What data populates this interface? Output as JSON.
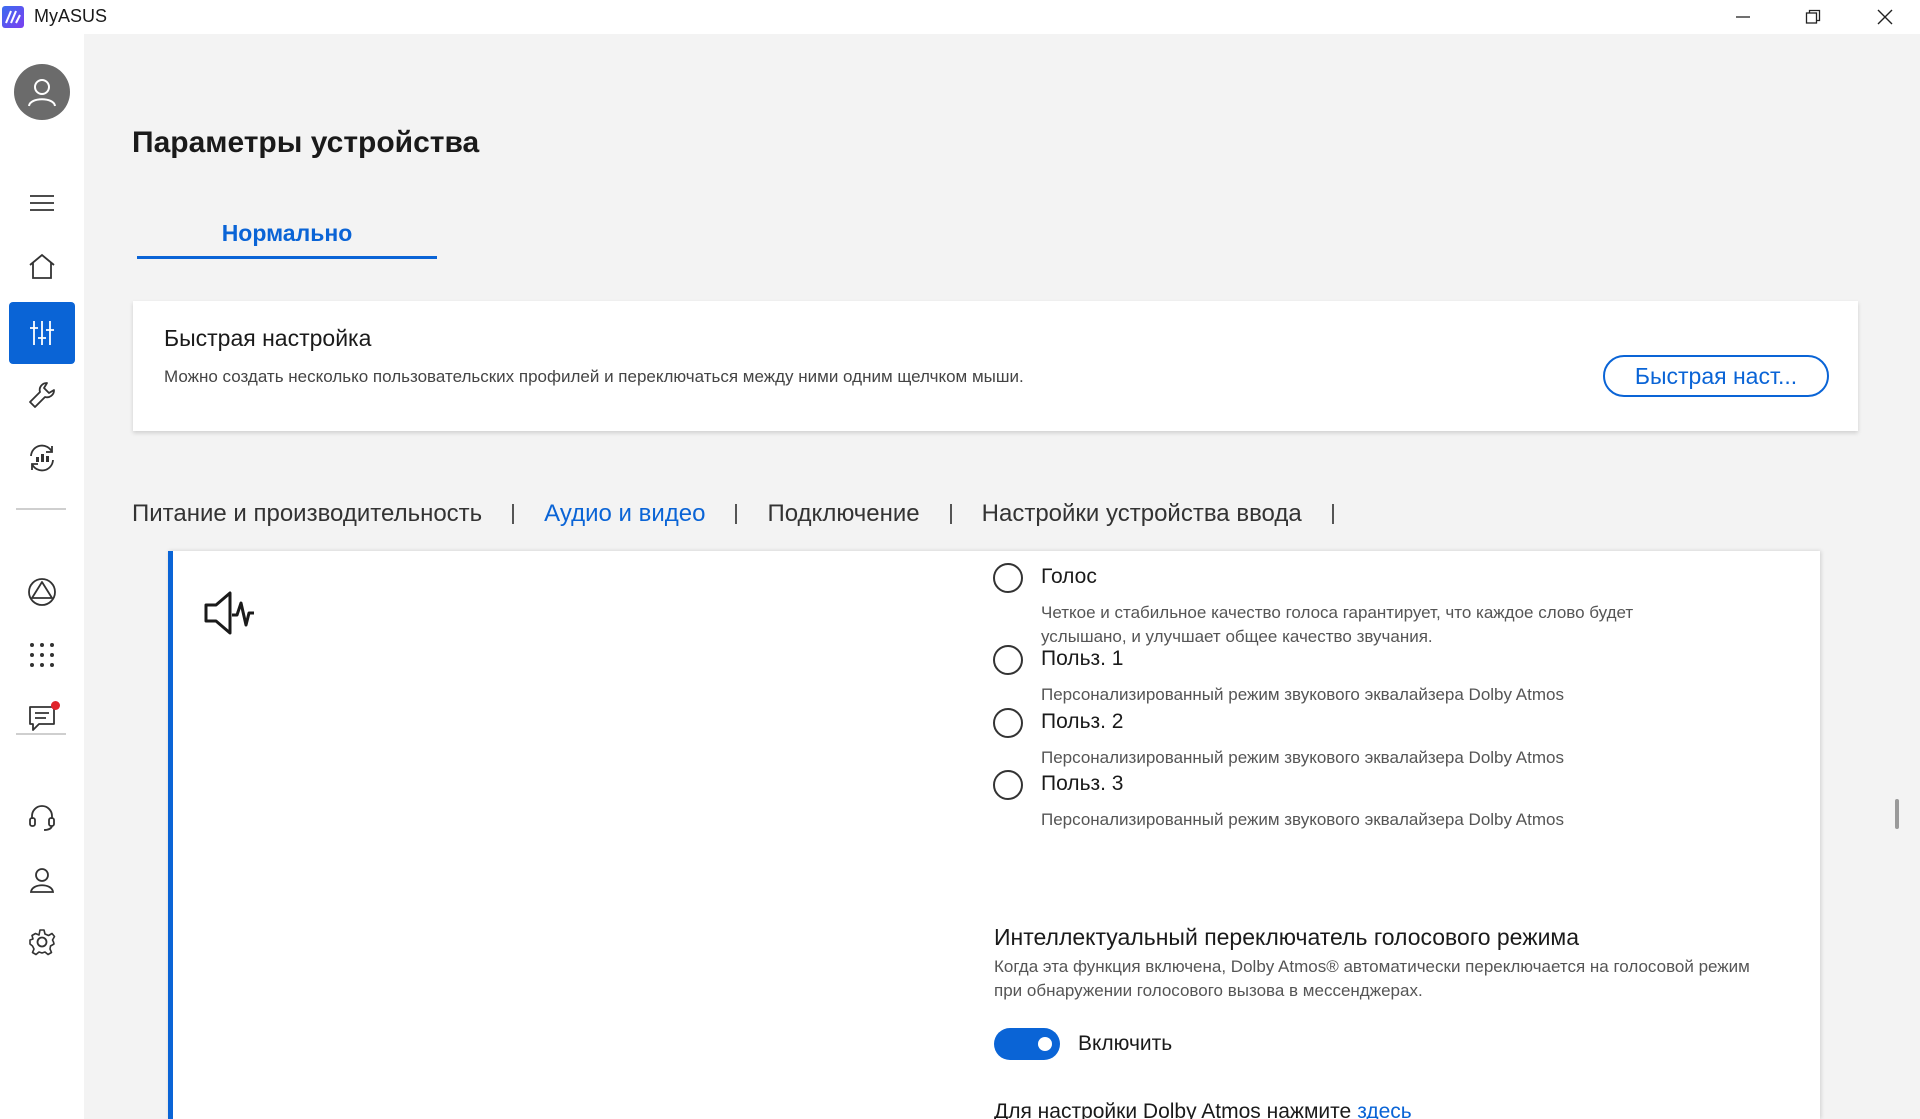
{
  "window": {
    "title": "MyASUS",
    "minimize_icon": "minimize-icon",
    "maximize_icon": "restore-icon",
    "close_icon": "close-icon"
  },
  "sidebar": {
    "items": [
      {
        "name": "menu",
        "icon": "hamburger-icon"
      },
      {
        "name": "home",
        "icon": "home-icon"
      },
      {
        "name": "device-settings",
        "icon": "sliders-icon",
        "active": true
      },
      {
        "name": "customization",
        "icon": "wrench-icon"
      },
      {
        "name": "system-diagnosis",
        "icon": "diagnosis-icon"
      },
      {
        "name": "link-to-myasus",
        "icon": "triangle-link-icon"
      },
      {
        "name": "apps",
        "icon": "grid-dots-icon"
      },
      {
        "name": "messages",
        "icon": "message-icon",
        "badge": true
      },
      {
        "name": "support",
        "icon": "headset-icon"
      },
      {
        "name": "account",
        "icon": "user-icon"
      },
      {
        "name": "settings",
        "icon": "gear-icon"
      }
    ]
  },
  "page": {
    "title": "Параметры устройства",
    "mode_tab": "Нормально"
  },
  "quick_setup": {
    "title": "Быстрая настройка",
    "description": "Можно создать несколько пользовательских профилей и переключаться между ними одним щелчком мыши.",
    "button_label": "Быстрая наст..."
  },
  "categories": [
    {
      "label": "Питание и производительность",
      "active": false
    },
    {
      "label": "Аудио и видео",
      "active": true
    },
    {
      "label": "Подключение",
      "active": false
    },
    {
      "label": "Настройки устройства ввода",
      "active": false
    }
  ],
  "audio": {
    "options": [
      {
        "label": "Голос",
        "description": "Четкое и стабильное качество голоса гарантирует, что каждое слово будет услышано, и улучшает общее качество звучания.",
        "selected": false
      },
      {
        "label": "Польз. 1",
        "description": "Персонализированный режим звукового эквалайзера Dolby Atmos",
        "selected": false
      },
      {
        "label": "Польз. 2",
        "description": "Персонализированный режим звукового эквалайзера Dolby Atmos",
        "selected": false
      },
      {
        "label": "Польз. 3",
        "description": "Персонализированный режим звукового эквалайзера Dolby Atmos",
        "selected": false
      }
    ],
    "smart_switch": {
      "title": "Интеллектуальный переключатель голосового режима",
      "description": "Когда эта функция включена, Dolby Atmos® автоматически переключается на голосовой режим при обнаружении голосового вызова в мессенджерах.",
      "toggle_label": "Включить",
      "enabled": true
    },
    "dolby_prompt": "Для настройки Dolby Atmos нажмите",
    "dolby_link": "здесь"
  },
  "colors": {
    "accent": "#0a64d6",
    "background": "#f3f3f3",
    "notification": "#e0242a"
  }
}
